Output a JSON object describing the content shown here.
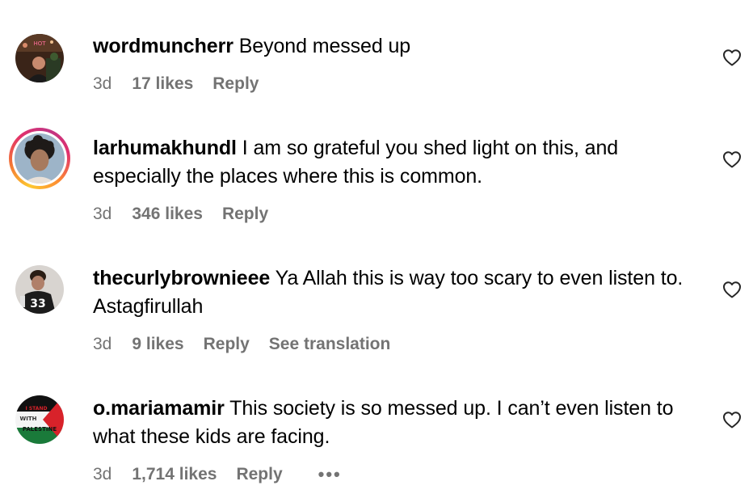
{
  "comments": [
    {
      "username": "wordmuncherr",
      "text": "Beyond messed up",
      "time": "3d",
      "likes": "17 likes",
      "reply": "Reply",
      "liked": false
    },
    {
      "username": "larhumakhundl",
      "text": "I am so grateful you shed light on this, and especially the places where this is common.",
      "time": "3d",
      "likes": "346 likes",
      "reply": "Reply",
      "liked": false
    },
    {
      "username": "thecurlybrownieee",
      "text": "Ya Allah this is way too scary to even listen to. Astagfirullah",
      "time": "3d",
      "likes": "9 likes",
      "reply": "Reply",
      "see_translation": "See translation",
      "liked": false
    },
    {
      "username": "o.mariamamir",
      "text": "This society is so messed up. I can’t even listen to what these kids are facing.",
      "time": "3d",
      "likes": "1,714 likes",
      "reply": "Reply",
      "more": "•••",
      "liked": false
    }
  ],
  "avatar_badge": {
    "line1": "I STAND",
    "line2": "WITH",
    "line3": "PALESTINE"
  },
  "colors": {
    "meta_text": "#737373",
    "heart_stroke": "#262626",
    "story_ring": [
      "#fdc830",
      "#e1306c",
      "#c13584"
    ]
  }
}
